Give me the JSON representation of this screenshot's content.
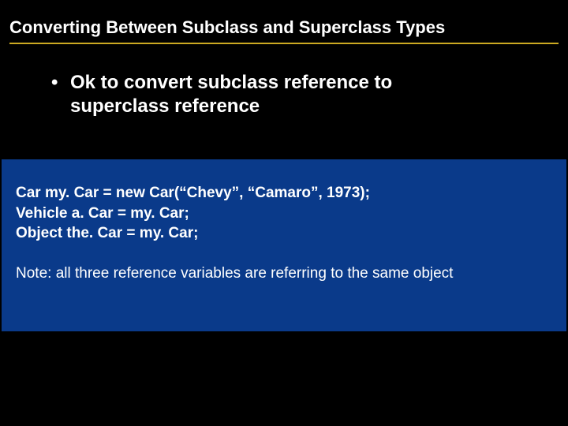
{
  "title": "Converting Between Subclass and Superclass Types",
  "bullet": {
    "marker": "•",
    "text_line1": "Ok to convert subclass reference to",
    "text_line2": "superclass reference"
  },
  "code": {
    "line1": "Car my. Car = new Car(“Chevy”, “Camaro”, 1973);",
    "line2": "Vehicle a. Car = my. Car;",
    "line3": "Object the. Car = my. Car;"
  },
  "note": "Note:  all three reference variables are referring to the same object"
}
